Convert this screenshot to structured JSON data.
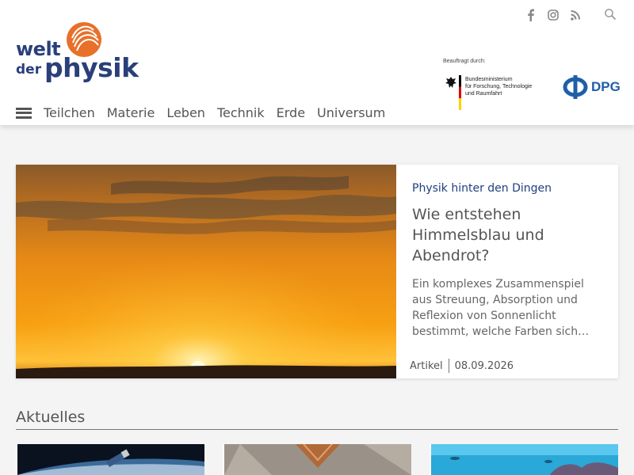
{
  "header": {
    "logo": {
      "line1": "welt",
      "line2": "der",
      "line3": "physik"
    },
    "social": {
      "facebook": "facebook-icon",
      "instagram": "instagram-icon",
      "rss": "rss-icon"
    },
    "search": "search-icon",
    "sponsor_label": "Beauftragt durch:",
    "bmbf_lines": [
      "Bundesministerium",
      "für Forschung, Technologie",
      "und Raumfahrt"
    ],
    "dpg_label": "DPG"
  },
  "nav": {
    "items": [
      "Teilchen",
      "Materie",
      "Leben",
      "Technik",
      "Erde",
      "Universum"
    ]
  },
  "feature": {
    "kicker": "Physik hinter den Dingen",
    "headline": "Wie entstehen Himmelsblau und Abendrot?",
    "teaser": "Ein komplexes Zusammenspiel aus Streuung, Absorption und Reflexion von Sonnenlicht bestimmt, welche Farben sich…",
    "type": "Artikel",
    "date": "08.09.2026"
  },
  "section": {
    "title": "Aktuelles"
  },
  "colors": {
    "brand_blue": "#2a3f7a",
    "kicker_blue": "#1f3f7f",
    "logo_orange": "#e8702a",
    "dpg_blue": "#1f5fa8"
  }
}
